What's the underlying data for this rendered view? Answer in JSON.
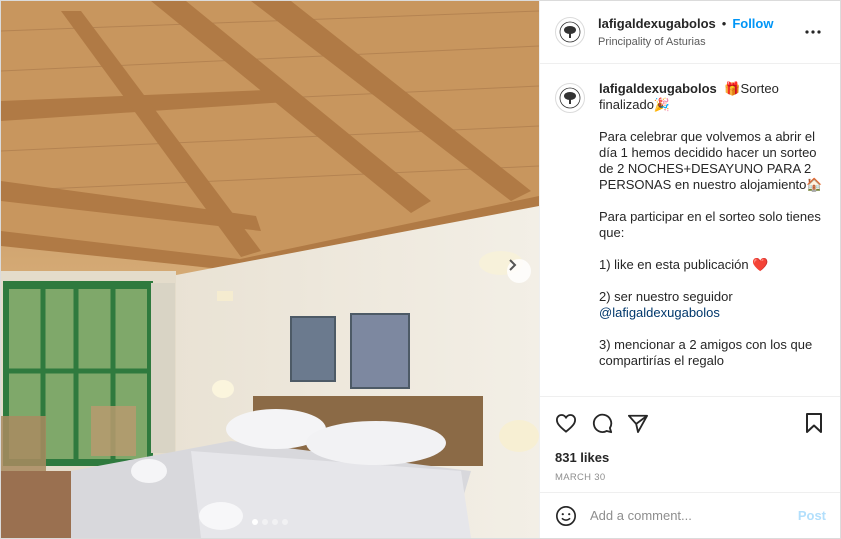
{
  "post": {
    "username": "lafigaldexugabolos",
    "follow_label": "Follow",
    "bullet": "•",
    "location": "Principality of Asturias",
    "caption": {
      "first_line": "🎁Sorteo finalizado🎉",
      "p1": "Para celebrar que volvemos a abrir el día 1 hemos decidido hacer un sorteo de 2 NOCHES+DESAYUNO PARA 2 PERSONAS en nuestro alojamiento🏠",
      "p2": "Para participar en el sorteo solo tienes que:",
      "p3": "1) like en esta publicación ❤️",
      "p4_prefix": "2) ser nuestro seguidor",
      "p4_mention": "@lafigaldexugabolos",
      "p5": "3) mencionar a 2 amigos con los que compartirías el regalo"
    },
    "likes": "831 likes",
    "date": "MARCH 30",
    "comment_placeholder": "Add a comment...",
    "post_label": "Post"
  },
  "carousel": {
    "slide_count": 4,
    "active_index": 0
  },
  "icons": {
    "more": "more-options-icon",
    "like": "heart-icon",
    "comment": "comment-icon",
    "share": "share-icon",
    "save": "bookmark-icon",
    "emoji": "emoji-icon",
    "next": "chevron-right-icon"
  },
  "colors": {
    "accent": "#0095f6",
    "post_disabled": "#b2dffc",
    "mention": "#00376b",
    "muted": "#8e8e8e"
  }
}
